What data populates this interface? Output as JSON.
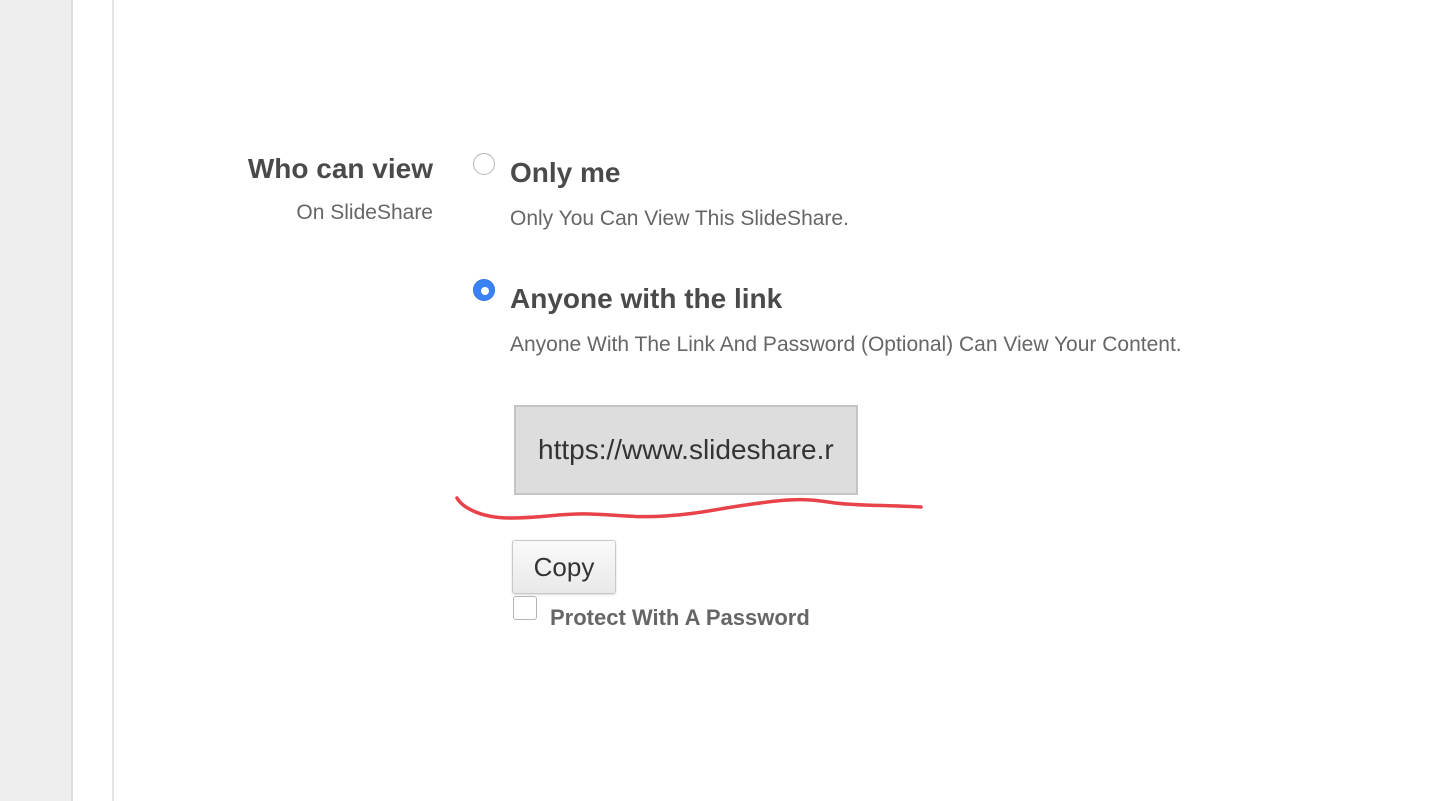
{
  "privacy": {
    "section_title": "Who can view",
    "section_subtitle": "On SlideShare",
    "options": [
      {
        "title": "Only me",
        "description": "Only You Can View This SlideShare.",
        "selected": false
      },
      {
        "title": "Anyone with the link",
        "description": "Anyone With The Link And Password (Optional) Can View Your Content.",
        "selected": true
      }
    ],
    "share_link": {
      "value": "https://www.slideshare.r",
      "copy_label": "Copy"
    },
    "password": {
      "label": "Protect With A Password",
      "checked": false
    }
  },
  "colors": {
    "accent": "#3b82f6",
    "annotation": "#e8434b"
  }
}
